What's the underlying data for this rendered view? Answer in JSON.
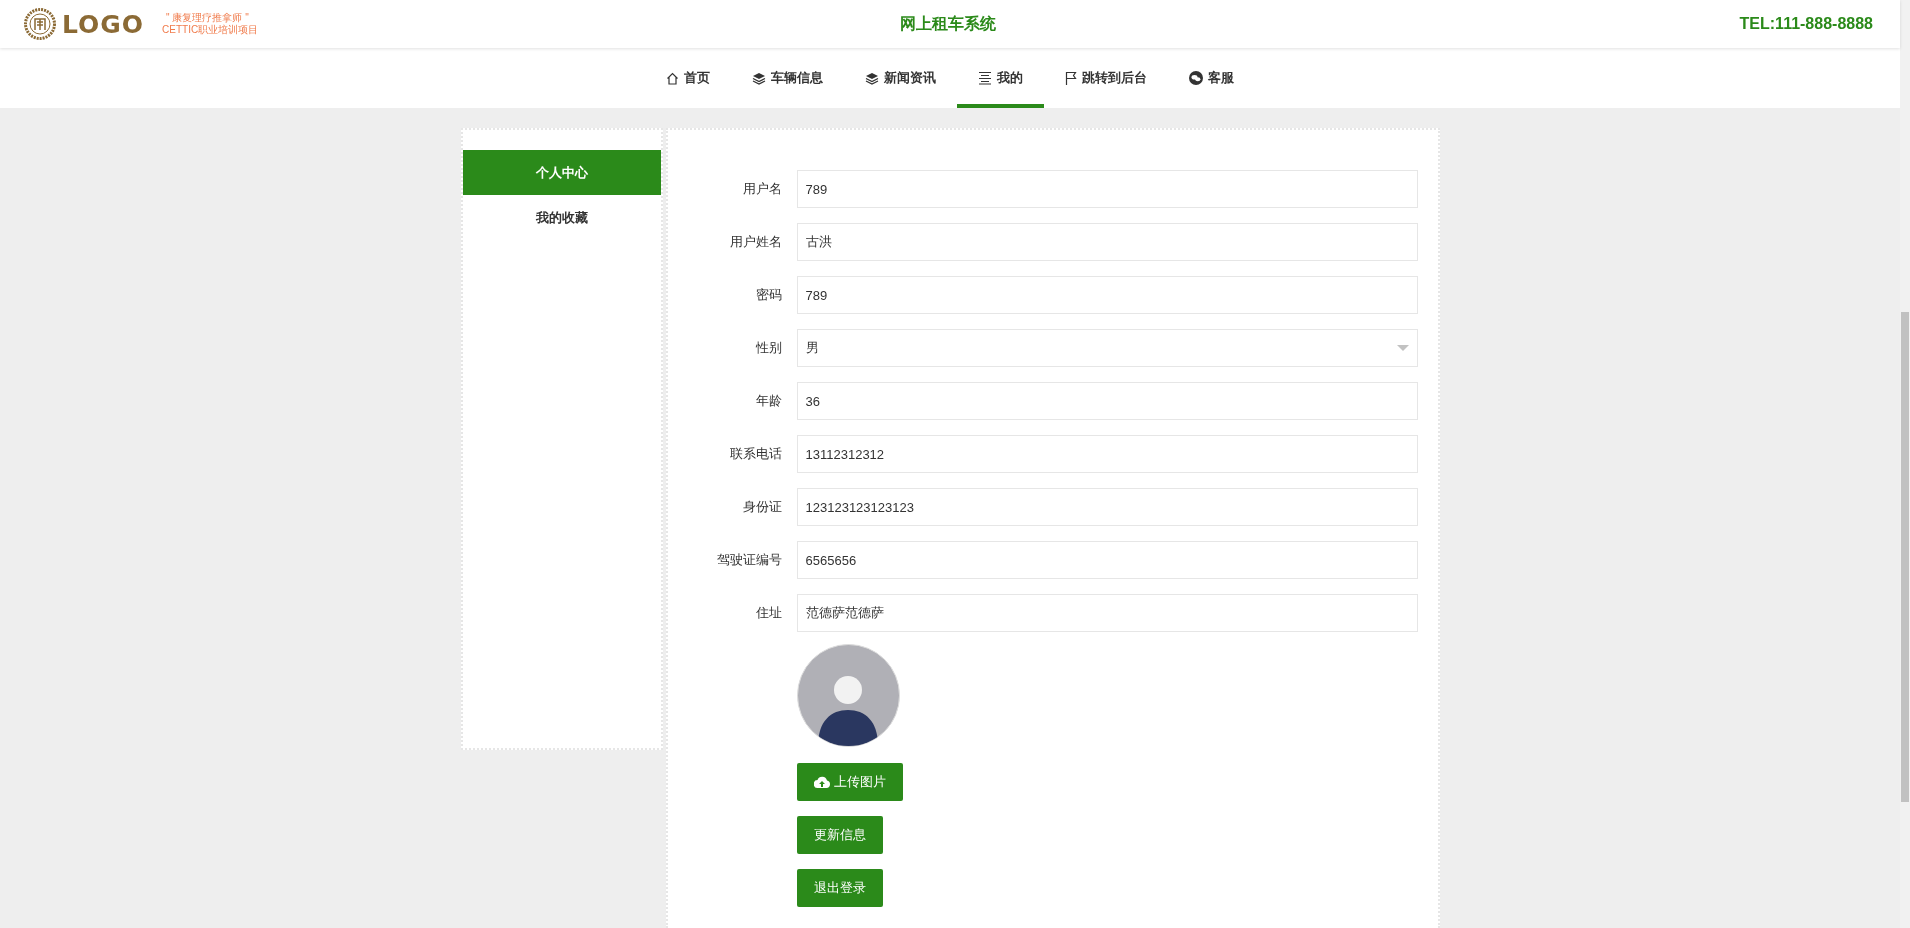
{
  "header": {
    "logo_text": "LOGO",
    "logo_tagline": "\" 康复理疗推拿师 \"",
    "logo_subtitle": "CETTIC职业培训项目",
    "title": "网上租车系统",
    "phone": "TEL:111-888-8888"
  },
  "nav": [
    {
      "label": "首页",
      "kind": "home",
      "selected": false
    },
    {
      "label": "车辆信息",
      "kind": "layers",
      "selected": false
    },
    {
      "label": "新闻资讯",
      "kind": "layers",
      "selected": false
    },
    {
      "label": "我的",
      "kind": "lines",
      "selected": true
    },
    {
      "label": "跳转到后台",
      "kind": "flag",
      "selected": false
    },
    {
      "label": "客服",
      "kind": "chat",
      "selected": false
    }
  ],
  "sidebar": {
    "items": [
      {
        "label": "个人中心",
        "selected": true
      },
      {
        "label": "我的收藏",
        "selected": false
      }
    ]
  },
  "form": {
    "fields": [
      {
        "label": "用户名",
        "kind": "text",
        "value": "789"
      },
      {
        "label": "用户姓名",
        "kind": "text",
        "value": "古洪"
      },
      {
        "label": "密码",
        "kind": "text",
        "value": "789"
      },
      {
        "label": "性别",
        "kind": "select",
        "value": "男"
      },
      {
        "label": "年龄",
        "kind": "text",
        "value": "36"
      },
      {
        "label": "联系电话",
        "kind": "text",
        "value": "13112312312"
      },
      {
        "label": "身份证",
        "kind": "text",
        "value": "123123123123123"
      },
      {
        "label": "驾驶证编号",
        "kind": "text",
        "value": "6565656"
      },
      {
        "label": "住址",
        "kind": "text",
        "value": "范德萨范德萨"
      }
    ],
    "buttons": [
      {
        "label": "上传图片",
        "kind": "upload"
      },
      {
        "label": "更新信息",
        "kind": "plain"
      },
      {
        "label": "退出登录",
        "kind": "plain"
      }
    ]
  }
}
